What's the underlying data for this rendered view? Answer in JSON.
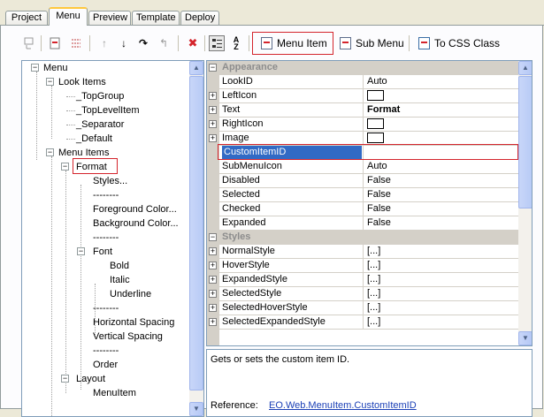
{
  "tabs": [
    {
      "label": "Project",
      "active": false
    },
    {
      "label": "Menu",
      "active": true
    },
    {
      "label": "Preview",
      "active": false
    },
    {
      "label": "Template",
      "active": false
    },
    {
      "label": "Deploy",
      "active": false
    }
  ],
  "toolbar": {
    "menu_item_label": "Menu Item",
    "sub_menu_label": "Sub Menu",
    "to_css_label": "To CSS Class",
    "sort_az_label": "A Z"
  },
  "colors": {
    "highlight": "#d4242c",
    "selection": "#316ac5",
    "link": "#1a3fb6"
  },
  "tree": {
    "items": [
      {
        "label": "Menu",
        "expander": "−"
      },
      {
        "label": "Look Items",
        "expander": "−"
      },
      {
        "label": "_TopGroup"
      },
      {
        "label": "_TopLevelItem"
      },
      {
        "label": "_Separator"
      },
      {
        "label": "_Default"
      },
      {
        "label": "Menu Items",
        "expander": "−"
      },
      {
        "label": "Format",
        "expander": "−"
      },
      {
        "label": "Styles..."
      },
      {
        "label": "--------"
      },
      {
        "label": "Foreground Color..."
      },
      {
        "label": "Background Color..."
      },
      {
        "label": "--------"
      },
      {
        "label": "Font",
        "expander": "−"
      },
      {
        "label": "Bold"
      },
      {
        "label": "Italic"
      },
      {
        "label": "Underline"
      },
      {
        "label": "--------"
      },
      {
        "label": "Horizontal Spacing"
      },
      {
        "label": "Vertical Spacing"
      },
      {
        "label": "--------"
      },
      {
        "label": "Order"
      },
      {
        "label": "Layout",
        "expander": "−"
      },
      {
        "label": "MenuItem"
      }
    ]
  },
  "properties": {
    "categories": {
      "appearance": "Appearance",
      "styles": "Styles"
    },
    "rows": [
      {
        "name": "LookID",
        "value": "Auto"
      },
      {
        "name": "LeftIcon",
        "value": ""
      },
      {
        "name": "Text",
        "value": "Format"
      },
      {
        "name": "RightIcon",
        "value": ""
      },
      {
        "name": "Image",
        "value": ""
      },
      {
        "name": "CustomItemID",
        "value": ""
      },
      {
        "name": "SubMenuIcon",
        "value": "Auto"
      },
      {
        "name": "Disabled",
        "value": "False"
      },
      {
        "name": "Selected",
        "value": "False"
      },
      {
        "name": "Checked",
        "value": "False"
      },
      {
        "name": "Expanded",
        "value": "False"
      },
      {
        "name": "NormalStyle",
        "value": "[...]"
      },
      {
        "name": "HoverStyle",
        "value": "[...]"
      },
      {
        "name": "ExpandedStyle",
        "value": "[...]"
      },
      {
        "name": "SelectedStyle",
        "value": "[...]"
      },
      {
        "name": "SelectedHoverStyle",
        "value": "[...]"
      },
      {
        "name": "SelectedExpandedStyle",
        "value": "[...]"
      }
    ]
  },
  "description": {
    "text": "Gets or sets the custom item ID.",
    "reference_label": "Reference:",
    "reference_link": "EO.Web.MenuItem.CustomItemID"
  }
}
